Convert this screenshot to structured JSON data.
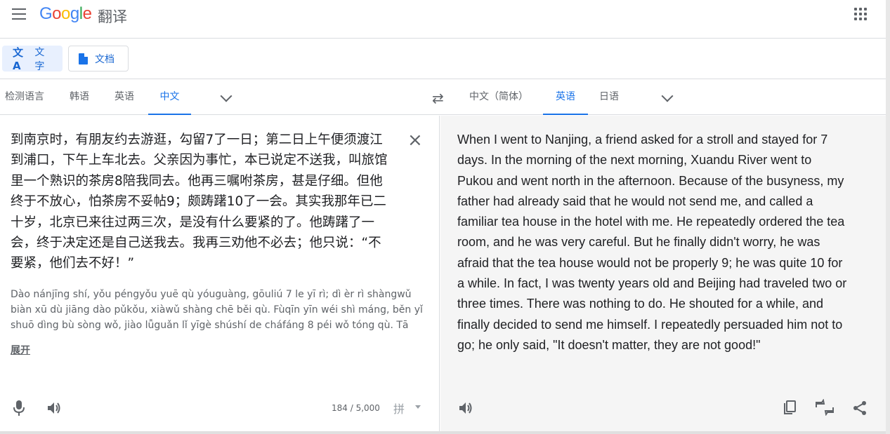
{
  "header": {
    "logo_parts": [
      "G",
      "o",
      "o",
      "g",
      "l",
      "e"
    ],
    "product": "翻译"
  },
  "modes": {
    "text_label": "文字",
    "doc_label": "文档"
  },
  "source_langs": [
    "检测语言",
    "韩语",
    "英语",
    "中文"
  ],
  "source_active": "中文",
  "target_langs": [
    "中文（简体）",
    "英语",
    "日语"
  ],
  "target_active": "英语",
  "source": {
    "text": "到南京时，有朋友约去游逛，勾留7了一日；第二日上午便须渡江到浦口，下午上车北去。父亲因为事忙，本已说定不送我，叫旅馆里一个熟识的茶房8陪我同去。他再三嘱咐茶房，甚是仔细。但他终于不放心，怕茶房不妥帖9；颇踌躇10了一会。其实我那年已二十岁，北京已来往过两三次，是没有什么要紧的了。他踌躇了一会，终于决定还是自己送我去。我再三劝他不必去；他只说：“不要紧，他们去不好！”",
    "transliteration": "Dào nánjīng shí, yǒu péngyǒu yuē qù yóuguàng, gōuliú 7 le yī rì; dì èr rì shàngwǔ biàn xū dù jiāng dào pǔkǒu, xiàwǔ shàng chē běi qù. Fùqīn yīn wéi shì máng, běn yǐ shuō dìng bù sòng wǒ, jiào lǚguǎn lǐ yīgè shúshí de cháfáng 8 péi wǒ tóng qù. Tā zàisān",
    "expand_label": "展开",
    "char_count": "184 / 5,000",
    "ime_label": "拼"
  },
  "target": {
    "text": "When I went to Nanjing, a friend asked for a stroll and stayed for 7 days. In the morning of the next morning, Xuandu River went to Pukou and went north in the afternoon. Because of the busyness, my father had already said that he would not send me, and called a familiar tea house in the hotel with me. He repeatedly ordered the tea room, and he was very careful. But he finally didn't worry, he was afraid that the tea house would not be properly 9; he was quite 10 for a while. In fact, I was twenty years old and Beijing had traveled two or three times. There was nothing to do. He shouted for a while, and finally decided to send me himself. I repeatedly persuaded him not to go; he only said, \"It doesn't matter, they are not good!\""
  },
  "colors": {
    "accent": "#1a73e8",
    "active_mode_bg": "#e8f0fe",
    "target_panel_bg": "#f5f5f5",
    "icon_gray": "#5f6368"
  },
  "icons": [
    "menu-icon",
    "apps-icon",
    "translate-icon",
    "document-icon",
    "swap-icon",
    "chevron-down-icon",
    "close-icon",
    "microphone-icon",
    "speaker-icon",
    "copy-icon",
    "feedback-icon",
    "share-icon"
  ]
}
